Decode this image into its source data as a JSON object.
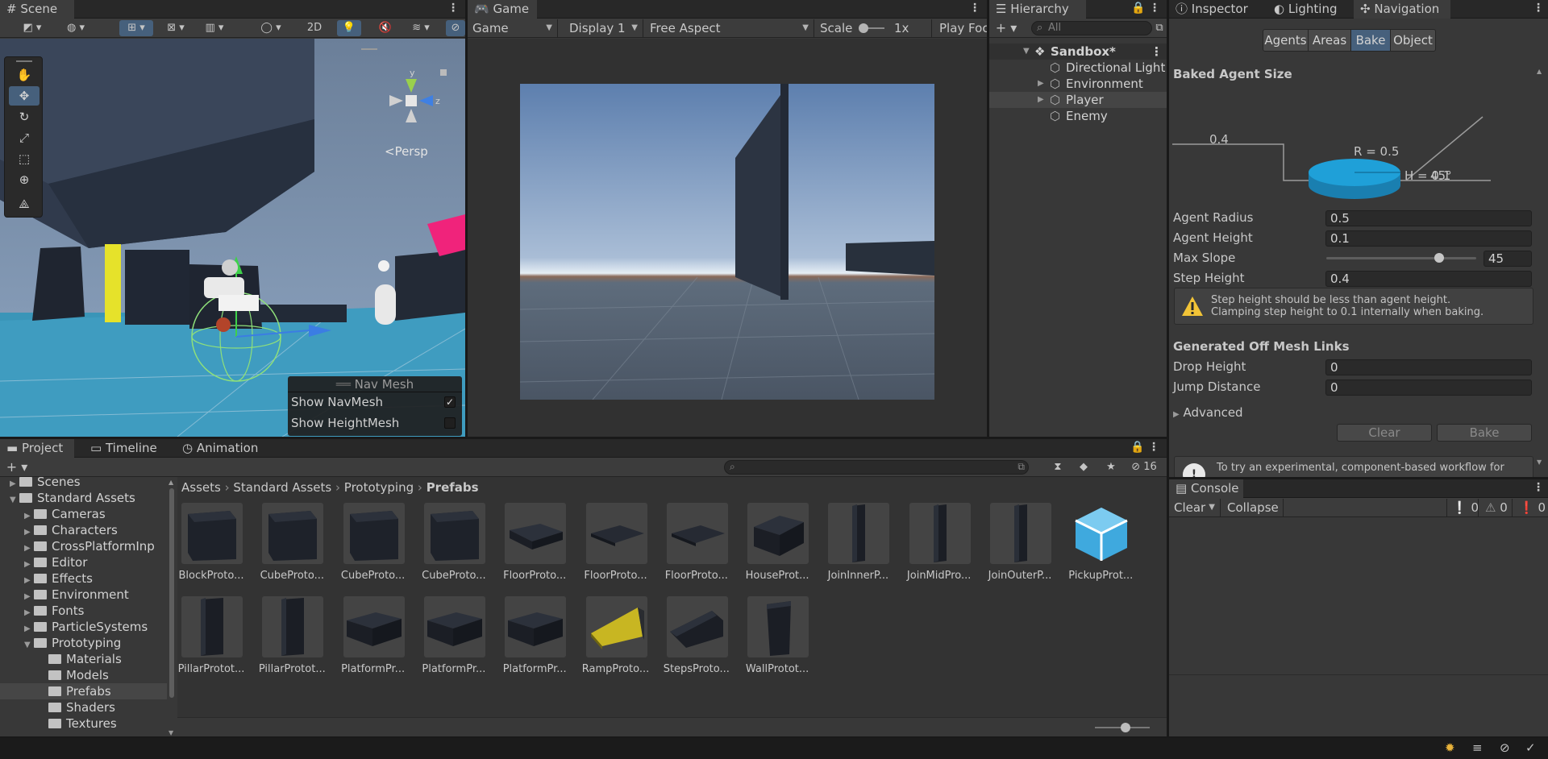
{
  "scene": {
    "tab": "Scene",
    "toggle_2d": "2D",
    "persp": "<Persp",
    "gizmo_axes": {
      "y": "y",
      "z": "z"
    },
    "overlay": {
      "title": "Nav Mesh",
      "show_navmesh": "Show NavMesh",
      "show_navmesh_checked": true,
      "show_heightmesh": "Show HeightMesh",
      "show_heightmesh_checked": false
    }
  },
  "game": {
    "tab": "Game",
    "mode": "Game",
    "display": "Display 1",
    "aspect": "Free Aspect",
    "scale_label": "Scale",
    "scale_value": "1x",
    "play_focus": "Play Foc"
  },
  "hierarchy": {
    "tab": "Hierarchy",
    "search_placeholder": "All",
    "scene_name": "Sandbox*",
    "items": [
      "Directional Light",
      "Environment",
      "Player",
      "Enemy"
    ]
  },
  "inspector": {
    "tabs": [
      "Inspector",
      "Lighting",
      "Navigation"
    ],
    "segments": [
      "Agents",
      "Areas",
      "Bake",
      "Object"
    ],
    "baked_agent_size": "Baked Agent Size",
    "diagram": {
      "step": "0.4",
      "radius": "R = 0.5",
      "height": "H = 0.1",
      "slope": "45°"
    },
    "agent_radius_label": "Agent Radius",
    "agent_radius": "0.5",
    "agent_height_label": "Agent Height",
    "agent_height": "0.1",
    "max_slope_label": "Max Slope",
    "max_slope": "45",
    "max_slope_fraction": 0.75,
    "step_height_label": "Step Height",
    "step_height": "0.4",
    "warning_line1": "Step height should be less than agent height.",
    "warning_line2": "Clamping step height to 0.1 internally when baking.",
    "offmesh_title": "Generated Off Mesh Links",
    "drop_height_label": "Drop Height",
    "drop_height": "0",
    "jump_distance_label": "Jump Distance",
    "jump_distance": "0",
    "advanced": "Advanced",
    "clear_button": "Clear",
    "bake_button": "Bake",
    "info": "To try an experimental, component-based workflow for"
  },
  "project": {
    "tabs": [
      "Project",
      "Timeline",
      "Animation"
    ],
    "search_placeholder": "",
    "hidden_count": "16",
    "tree": [
      {
        "label": "Scenes"
      },
      {
        "label": "Standard Assets"
      },
      {
        "label": "Cameras"
      },
      {
        "label": "Characters"
      },
      {
        "label": "CrossPlatformInp"
      },
      {
        "label": "Editor"
      },
      {
        "label": "Effects"
      },
      {
        "label": "Environment"
      },
      {
        "label": "Fonts"
      },
      {
        "label": "ParticleSystems"
      },
      {
        "label": "Prototyping"
      },
      {
        "label": "Materials"
      },
      {
        "label": "Models"
      },
      {
        "label": "Prefabs"
      },
      {
        "label": "Shaders"
      },
      {
        "label": "Textures"
      }
    ],
    "breadcrumb": [
      "Assets",
      "Standard Assets",
      "Prototyping",
      "Prefabs"
    ],
    "assets": [
      "BlockProto...",
      "CubeProto...",
      "CubeProto...",
      "CubeProto...",
      "FloorProto...",
      "FloorProto...",
      "FloorProto...",
      "HouseProt...",
      "JoinInnerP...",
      "JoinMidPro...",
      "JoinOuterP...",
      "PickupProt...",
      "PillarProtot...",
      "PillarProtot...",
      "PlatformPr...",
      "PlatformPr...",
      "PlatformPr...",
      "RampProto...",
      "StepsProto...",
      "WallProtot..."
    ]
  },
  "console": {
    "tab": "Console",
    "clear": "Clear",
    "collapse": "Collapse",
    "info_count": "0",
    "warn_count": "0",
    "error_count": "0"
  },
  "colors": {
    "accent": "#46607c",
    "pickup": "#3fa9de",
    "diagram_disc": "#1fa0d8"
  }
}
